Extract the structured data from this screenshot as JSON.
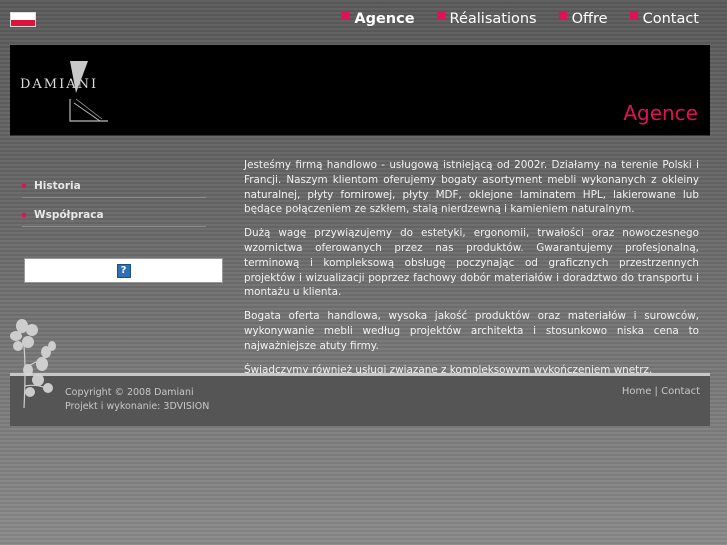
{
  "nav": {
    "items": [
      {
        "label": "Agence",
        "active": true
      },
      {
        "label": "Réalisations",
        "active": false
      },
      {
        "label": "Offre",
        "active": false
      },
      {
        "label": "Contact",
        "active": false
      }
    ]
  },
  "header": {
    "logo_text": "DAMIANI",
    "section_title": "Agence"
  },
  "sidebar": {
    "items": [
      {
        "label": "Historia"
      },
      {
        "label": "Współpraca"
      }
    ]
  },
  "content": {
    "paragraphs": [
      "Jesteśmy firmą handlowo - usługową istniejącą od 2002r. Działamy na terenie Polski i Francji. Naszym klientom oferujemy bogaty asortyment mebli wykonanych z okleiny naturalnej, płyty fornirowej, płyty MDF, oklejone laminatem HPL, lakierowane lub będące połączeniem ze szkłem, stalą nierdzewną i kamieniem naturalnym.",
      "Dużą wagę przywiązujemy do estetyki, ergonomii, trwałości oraz nowoczesnego wzornictwa oferowanych przez nas produktów. Gwarantujemy profesjonalną, terminową i kompleksową obsługę poczynając od graficznych przestrzennych projektów i wizualizacji poprzez fachowy dobór materiałów i doradztwo do transportu i montażu u klienta.",
      "Bogata oferta handlowa, wysoka jakość produktów oraz materiałów i surowców, wykonywanie mebli według projektów architekta i stosunkowo niska cena to najważniejsze atuty firmy.",
      "Świadczymy również usługi związane z kompleksowym wykończeniem wnętrz."
    ]
  },
  "footer": {
    "copyright": "Copyright © 2008 Damiani",
    "credits": "Projekt i wykonanie: 3DVISION",
    "link_home": "Home",
    "separator": "|",
    "link_contact": "Contact"
  },
  "colors": {
    "accent": "#e0105a",
    "header_bg": "#000000",
    "footer_bg": "#555555"
  },
  "icons": {
    "flag": "poland-flag-icon",
    "help": "question-mark-icon",
    "decoration": "flower-icon"
  }
}
